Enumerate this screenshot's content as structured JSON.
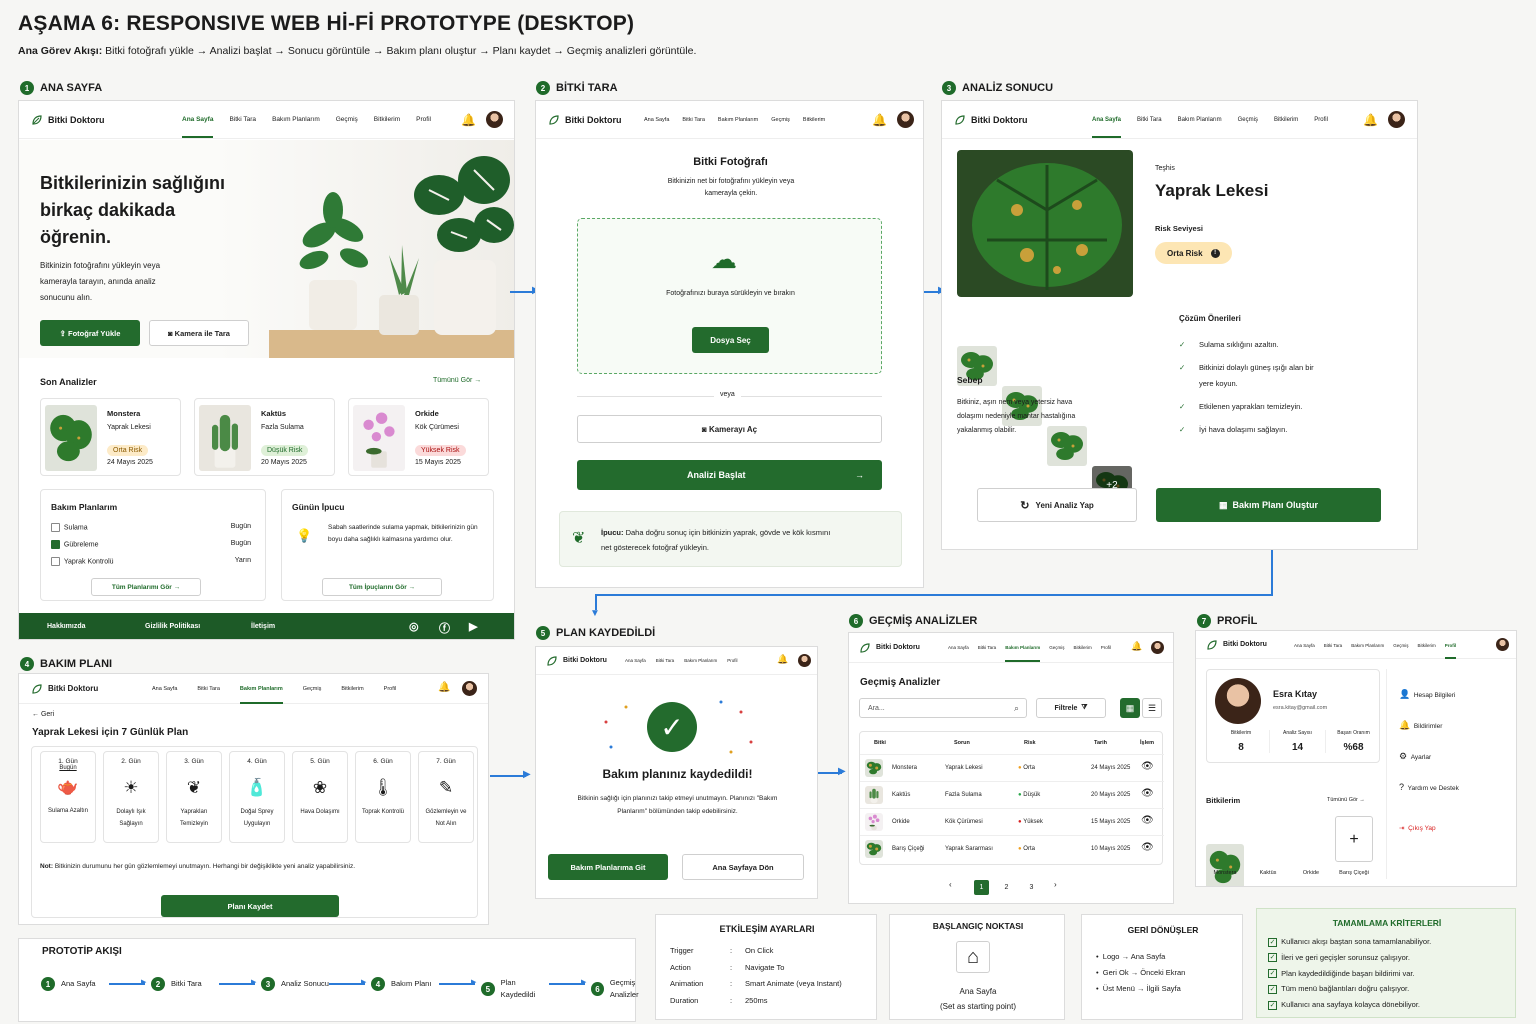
{
  "header": {
    "title": "AŞAMA 6: RESPONSIVE WEB Hİ-Fİ PROTOTYPE (DESKTOP)",
    "flow_label": "Ana Görev Akışı:",
    "flow_text": "Bitki fotoğrafı yükle → Analizi başlat → Sonucu görüntüle → Bakım planı oluştur → Planı kaydet → Geçmiş analizleri görüntüle."
  },
  "brand": "Bitki Doktoru",
  "menu": [
    "Ana Sayfa",
    "Bitki Tara",
    "Bakım Planlarım",
    "Geçmiş",
    "Bitkilerim",
    "Profil"
  ],
  "s1": {
    "num": "1",
    "title": "ANA SAYFA",
    "hero": "Bitkilerinizin sağlığını birkaç dakikada öğrenin.",
    "hero_sub": "Bitkinizin fotoğrafını yükleyin veya kamerayla tarayın, anında analiz sonucunu alın.",
    "upload": "Fotoğraf Yükle",
    "camera": "Kamera ile Tara",
    "recent": "Son Analizler",
    "see_all": "Tümünü Gör",
    "cards": [
      {
        "name": "Monstera",
        "issue": "Yaprak Lekesi",
        "risk": "Orta Risk",
        "date": "24 Mayıs 2025"
      },
      {
        "name": "Kaktüs",
        "issue": "Fazla Sulama",
        "risk": "Düşük Risk",
        "date": "20 Mayıs 2025"
      },
      {
        "name": "Orkide",
        "issue": "Kök Çürümesi",
        "risk": "Yüksek Risk",
        "date": "15 Mayıs 2025"
      }
    ],
    "plans_title": "Bakım Planlarım",
    "plans": [
      {
        "t": "Sulama",
        "d": "Bugün"
      },
      {
        "t": "Gübreleme",
        "d": "Bugün"
      },
      {
        "t": "Yaprak Kontrolü",
        "d": "Yarın"
      }
    ],
    "plans_btn": "Tüm Planlarımı Gör",
    "tip_title": "Günün İpucu",
    "tip": "Sabah saatlerinde sulama yapmak, bitkilerinizin gün boyu daha sağlıklı kalmasına yardımcı olur.",
    "tip_btn": "Tüm İpuçlarını Gör",
    "footer": [
      "Hakkımızda",
      "Gizlilik Politikası",
      "İletişim"
    ]
  },
  "s2": {
    "num": "2",
    "title": "BİTKİ TARA",
    "head": "Bitki Fotoğrafı",
    "desc": "Bitkinizin net bir fotoğrafını yükleyin veya kamerayla çekin.",
    "drop": "Fotoğrafınızı buraya sürükleyin ve bırakın",
    "choose": "Dosya Seç",
    "or": "veya",
    "cam": "Kamerayı Aç",
    "start": "Analizi Başlat",
    "tip_b": "İpucu:",
    "tip": "Daha doğru sonuç için bitkinizin yaprak, gövde ve kök kısmını net gösterecek fotoğraf yükleyin."
  },
  "s3": {
    "num": "3",
    "title": "ANALİZ SONUCU",
    "diag_l": "Teşhis",
    "diag": "Yaprak Lekesi",
    "risk_l": "Risk Seviyesi",
    "risk": "Orta Risk",
    "more": "+2",
    "cause_t": "Sebep",
    "cause": "Bitkiniz, aşırı nem veya yetersiz hava dolaşımı nedeniyle mantar hastalığına yakalanmış olabilir.",
    "sol_t": "Çözüm Önerileri",
    "sols": [
      "Sulama sıklığını azaltın.",
      "Bitkinizi dolaylı güneş ışığı alan bir yere koyun.",
      "Etkilenen yaprakları temizleyin.",
      "İyi hava dolaşımı sağlayın."
    ],
    "new": "Yeni Analiz Yap",
    "plan": "Bakım Planı Oluştur"
  },
  "s4": {
    "num": "4",
    "title": "BAKIM PLANI",
    "back": "Geri",
    "head": "Yaprak Lekesi için 7 Günlük Plan",
    "days": [
      {
        "d": "1. Gün",
        "s": "Bugün",
        "t": "Sulama Azaltın"
      },
      {
        "d": "2. Gün",
        "t": "Dolaylı Işık Sağlayın"
      },
      {
        "d": "3. Gün",
        "t": "Yaprakları Temizleyin"
      },
      {
        "d": "4. Gün",
        "t": "Doğal Sprey Uygulayın"
      },
      {
        "d": "5. Gün",
        "t": "Hava Dolaşımı"
      },
      {
        "d": "6. Gün",
        "t": "Toprak Kontrolü"
      },
      {
        "d": "7. Gün",
        "t": "Gözlemleyin ve Not Alın"
      }
    ],
    "note_b": "Not:",
    "note": "Bitkinizin durumunu her gün gözlemlemeyi unutmayın. Herhangi bir değişiklikte yeni analiz yapabilirsiniz.",
    "save": "Planı Kaydet"
  },
  "s5": {
    "num": "5",
    "title": "PLAN KAYDEDİLDİ",
    "head": "Bakım planınız kaydedildi!",
    "desc": "Bitkinin sağlığı için planınızı takip etmeyi unutmayın. Planınızı \"Bakım Planlarım\" bölümünden takip edebilirsiniz.",
    "go": "Bakım Planlarıma Git",
    "home": "Ana Sayfaya Dön"
  },
  "s6": {
    "num": "6",
    "title": "GEÇMİŞ ANALİZLER",
    "head": "Geçmiş Analizler",
    "search": "Ara...",
    "filter": "Filtrele",
    "cols": [
      "Bitki",
      "Sorun",
      "Risk",
      "Tarih",
      "İşlem"
    ],
    "rows": [
      {
        "p": "Monstera",
        "s": "Yaprak Lekesi",
        "r": "Orta",
        "d": "24 Mayıs 2025",
        "c": "#f0a020"
      },
      {
        "p": "Kaktüs",
        "s": "Fazla Sulama",
        "r": "Düşük",
        "d": "20 Mayıs 2025",
        "c": "#2aa84a"
      },
      {
        "p": "Orkide",
        "s": "Kök Çürümesi",
        "r": "Yüksek",
        "d": "15 Mayıs 2025",
        "c": "#d82020"
      },
      {
        "p": "Barış Çiçeği",
        "s": "Yaprak Sararması",
        "r": "Orta",
        "d": "10 Mayıs 2025",
        "c": "#f0a020"
      }
    ],
    "pages": [
      "1",
      "2",
      "3"
    ]
  },
  "s7": {
    "num": "7",
    "title": "PROFİL",
    "name": "Esra Kıtay",
    "email": "esra.kitay@gmail.com",
    "stats": [
      {
        "l": "Bitkilerim",
        "v": "8"
      },
      {
        "l": "Analiz Sayısı",
        "v": "14"
      },
      {
        "l": "Başarı Oranım",
        "v": "%68"
      }
    ],
    "plants_t": "Bitkilerim",
    "see_all": "Tümünü Gör",
    "plants": [
      "Monstera",
      "Kaktüs",
      "Orkide",
      "Barış Çiçeği"
    ],
    "links": [
      "Hesap Bilgileri",
      "Bildirimler",
      "Ayarlar",
      "Yardım ve Destek"
    ],
    "logout": "Çıkış Yap"
  },
  "proto": {
    "title": "PROTOTİP AKIŞI",
    "steps": [
      "Ana Sayfa",
      "Bitki Tara",
      "Analiz Sonucu",
      "Bakım Planı",
      "Plan Kaydedildi",
      "Geçmiş Analizler"
    ]
  },
  "interaction": {
    "title": "ETKİLEŞİM AYARLARI",
    "rows": [
      {
        "k": "Trigger",
        "v": "On Click"
      },
      {
        "k": "Action",
        "v": "Navigate To"
      },
      {
        "k": "Animation",
        "v": "Smart Animate (veya Instant)"
      },
      {
        "k": "Duration",
        "v": "250ms"
      }
    ]
  },
  "start": {
    "title": "BAŞLANGIÇ NOKTASI",
    "label": "Ana Sayfa",
    "note": "(Set as starting point)"
  },
  "back": {
    "title": "GERİ DÖNÜŞLER",
    "items": [
      "Logo → Ana Sayfa",
      "Geri Ok → Önceki Ekran",
      "Üst Menü → İlgili Sayfa"
    ]
  },
  "done": {
    "title": "TAMAMLAMA KRİTERLERİ",
    "items": [
      "Kullanıcı akışı baştan sona tamamlanabiliyor.",
      "İleri ve geri geçişler sorunsuz çalışıyor.",
      "Plan kaydedildiğinde başarı bildirimi var.",
      "Tüm menü bağlantıları doğru çalışıyor.",
      "Kullanıcı ana sayfaya kolayca dönebiliyor."
    ]
  },
  "colors": {
    "green": "#236b2d",
    "blue": "#2b7bd8"
  }
}
